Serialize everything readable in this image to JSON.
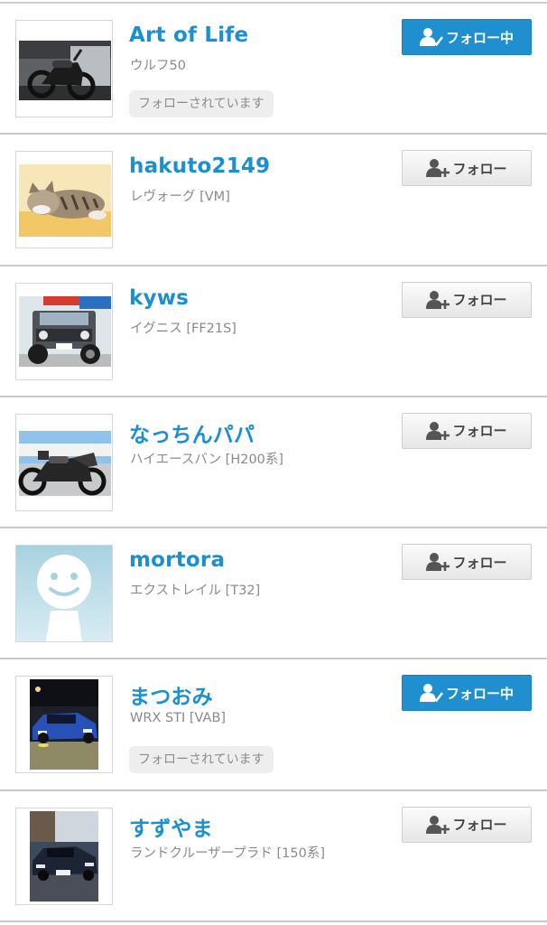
{
  "follow_label": "フォロー",
  "following_label": "フォロー中",
  "followed_badge_label": "フォローされています",
  "colors": {
    "name_blue": "#1b8fcf",
    "following_button_bg": "#1f8fcf",
    "follow_button_bg": "#eeeeee",
    "car_text_gray": "#8a8a8a"
  },
  "users": [
    {
      "name": "Art of Life",
      "car": "ウルフ50",
      "button_state": "following",
      "follows_you": true,
      "avatar": "motorcycle-garage-photo"
    },
    {
      "name": "hakuto2149",
      "car": "レヴォーグ [VM]",
      "button_state": "follow",
      "follows_you": false,
      "avatar": "cat-photo"
    },
    {
      "name": "kyws",
      "car": "イグニス [FF21S]",
      "button_state": "follow",
      "follows_you": false,
      "avatar": "jimny-photo"
    },
    {
      "name": "なっちんパパ",
      "car": "ハイエースバン [H200系]",
      "button_state": "follow",
      "follows_you": false,
      "avatar": "sport-bike-photo"
    },
    {
      "name": "mortora",
      "car": "エクストレイル [T32]",
      "button_state": "follow",
      "follows_you": false,
      "avatar": "default-avatar"
    },
    {
      "name": "まつおみ",
      "car": "WRX STI [VAB]",
      "button_state": "following",
      "follows_you": true,
      "avatar": "blue-wrx-night-photo"
    },
    {
      "name": "すずやま",
      "car": "ランドクルーザープラド [150系]",
      "button_state": "follow",
      "follows_you": false,
      "avatar": "sedan-photo"
    }
  ]
}
